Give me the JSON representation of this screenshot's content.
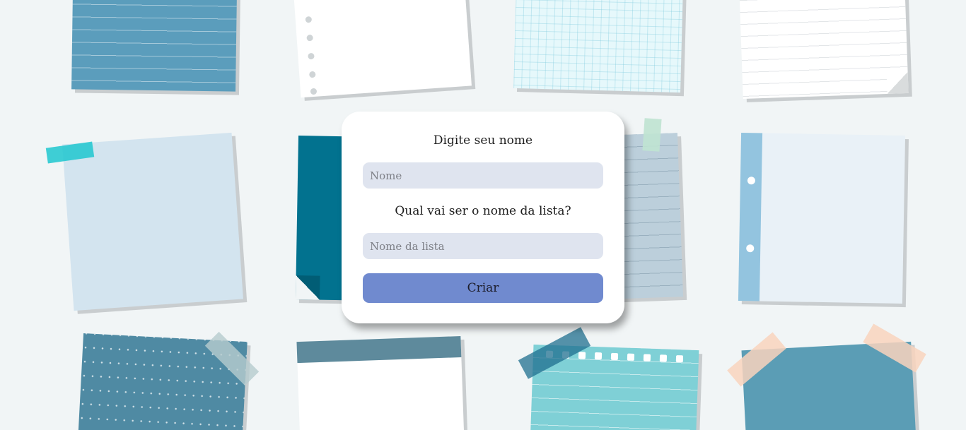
{
  "form": {
    "name_label": "Digite seu nome",
    "name_placeholder": "Nome",
    "name_value": "",
    "list_label": "Qual vai ser o nome da lista?",
    "list_placeholder": "Nome da lista",
    "list_value": "",
    "submit_label": "Criar"
  },
  "colors": {
    "background": "#f1f5f6",
    "card": "#ffffff",
    "input_bg": "#dfe4ef",
    "button": "#708acf"
  },
  "decorations": [
    "blue-lined-note",
    "ring-binder-note",
    "grid-note",
    "white-lined-note",
    "light-blue-note",
    "teal-folded-note",
    "grey-lined-note",
    "binder-strip-note",
    "dotted-note",
    "white-header-note",
    "spiral-note",
    "blue-taped-note"
  ]
}
